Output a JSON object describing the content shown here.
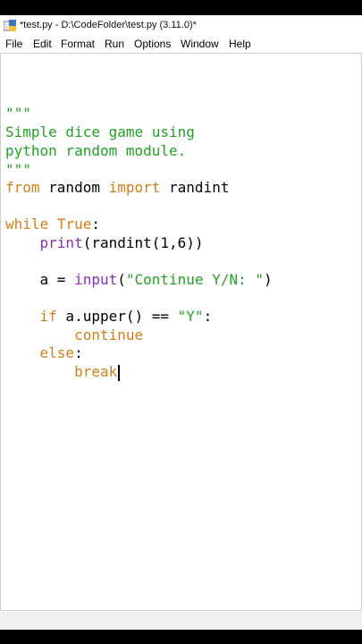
{
  "window": {
    "title": "*test.py - D:\\CodeFolder\\test.py (3.11.0)*"
  },
  "menu": {
    "items": [
      "File",
      "Edit",
      "Format",
      "Run",
      "Options",
      "Window",
      "Help"
    ]
  },
  "editor": {
    "lines": [
      {
        "text": "\"\"\"",
        "tokens": [
          {
            "t": "\"\"\"",
            "c": "str"
          }
        ]
      },
      {
        "text": "Simple dice game using",
        "tokens": [
          {
            "t": "Simple dice game using",
            "c": "str"
          }
        ]
      },
      {
        "text": "python random module.",
        "tokens": [
          {
            "t": "python random module.",
            "c": "str"
          }
        ]
      },
      {
        "text": "\"\"\"",
        "tokens": [
          {
            "t": "\"\"\"",
            "c": "str"
          }
        ]
      },
      {
        "text": "from random import randint",
        "tokens": [
          {
            "t": "from",
            "c": "kw"
          },
          {
            "t": " random ",
            "c": ""
          },
          {
            "t": "import",
            "c": "kw"
          },
          {
            "t": " randint",
            "c": ""
          }
        ]
      },
      {
        "text": "",
        "tokens": []
      },
      {
        "text": "while True:",
        "tokens": [
          {
            "t": "while",
            "c": "kw"
          },
          {
            "t": " ",
            "c": ""
          },
          {
            "t": "True",
            "c": "kw"
          },
          {
            "t": ":",
            "c": ""
          }
        ]
      },
      {
        "text": "    print(randint(1,6))",
        "tokens": [
          {
            "t": "    ",
            "c": ""
          },
          {
            "t": "print",
            "c": "bi"
          },
          {
            "t": "(randint(1,6))",
            "c": ""
          }
        ]
      },
      {
        "text": "",
        "tokens": []
      },
      {
        "text": "    a = input(\"Continue Y/N: \")",
        "tokens": [
          {
            "t": "    a = ",
            "c": ""
          },
          {
            "t": "input",
            "c": "bi"
          },
          {
            "t": "(",
            "c": ""
          },
          {
            "t": "\"Continue Y/N: \"",
            "c": "str"
          },
          {
            "t": ")",
            "c": ""
          }
        ]
      },
      {
        "text": "",
        "tokens": []
      },
      {
        "text": "    if a.upper() == \"Y\":",
        "tokens": [
          {
            "t": "    ",
            "c": ""
          },
          {
            "t": "if",
            "c": "kw"
          },
          {
            "t": " a.upper() == ",
            "c": ""
          },
          {
            "t": "\"Y\"",
            "c": "str"
          },
          {
            "t": ":",
            "c": ""
          }
        ]
      },
      {
        "text": "        continue",
        "tokens": [
          {
            "t": "        ",
            "c": ""
          },
          {
            "t": "continue",
            "c": "kw"
          }
        ]
      },
      {
        "text": "    else:",
        "tokens": [
          {
            "t": "    ",
            "c": ""
          },
          {
            "t": "else",
            "c": "kw"
          },
          {
            "t": ":",
            "c": ""
          }
        ]
      },
      {
        "text": "        break",
        "tokens": [
          {
            "t": "        ",
            "c": ""
          },
          {
            "t": "break",
            "c": "kw"
          }
        ]
      }
    ],
    "cursor_line": 15
  },
  "colors": {
    "string": "#22a222",
    "keyword": "#d07f1a",
    "builtin": "#8b2fb8"
  }
}
